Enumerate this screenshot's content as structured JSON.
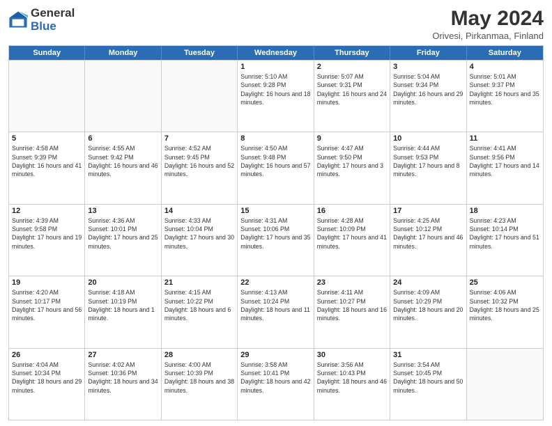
{
  "header": {
    "logo_general": "General",
    "logo_blue": "Blue",
    "month_year": "May 2024",
    "location": "Orivesi, Pirkanmaa, Finland"
  },
  "weekdays": [
    "Sunday",
    "Monday",
    "Tuesday",
    "Wednesday",
    "Thursday",
    "Friday",
    "Saturday"
  ],
  "weeks": [
    [
      {
        "day": "",
        "sunrise": "",
        "sunset": "",
        "daylight": ""
      },
      {
        "day": "",
        "sunrise": "",
        "sunset": "",
        "daylight": ""
      },
      {
        "day": "",
        "sunrise": "",
        "sunset": "",
        "daylight": ""
      },
      {
        "day": "1",
        "sunrise": "Sunrise: 5:10 AM",
        "sunset": "Sunset: 9:28 PM",
        "daylight": "Daylight: 16 hours and 18 minutes."
      },
      {
        "day": "2",
        "sunrise": "Sunrise: 5:07 AM",
        "sunset": "Sunset: 9:31 PM",
        "daylight": "Daylight: 16 hours and 24 minutes."
      },
      {
        "day": "3",
        "sunrise": "Sunrise: 5:04 AM",
        "sunset": "Sunset: 9:34 PM",
        "daylight": "Daylight: 16 hours and 29 minutes."
      },
      {
        "day": "4",
        "sunrise": "Sunrise: 5:01 AM",
        "sunset": "Sunset: 9:37 PM",
        "daylight": "Daylight: 16 hours and 35 minutes."
      }
    ],
    [
      {
        "day": "5",
        "sunrise": "Sunrise: 4:58 AM",
        "sunset": "Sunset: 9:39 PM",
        "daylight": "Daylight: 16 hours and 41 minutes."
      },
      {
        "day": "6",
        "sunrise": "Sunrise: 4:55 AM",
        "sunset": "Sunset: 9:42 PM",
        "daylight": "Daylight: 16 hours and 46 minutes."
      },
      {
        "day": "7",
        "sunrise": "Sunrise: 4:52 AM",
        "sunset": "Sunset: 9:45 PM",
        "daylight": "Daylight: 16 hours and 52 minutes."
      },
      {
        "day": "8",
        "sunrise": "Sunrise: 4:50 AM",
        "sunset": "Sunset: 9:48 PM",
        "daylight": "Daylight: 16 hours and 57 minutes."
      },
      {
        "day": "9",
        "sunrise": "Sunrise: 4:47 AM",
        "sunset": "Sunset: 9:50 PM",
        "daylight": "Daylight: 17 hours and 3 minutes."
      },
      {
        "day": "10",
        "sunrise": "Sunrise: 4:44 AM",
        "sunset": "Sunset: 9:53 PM",
        "daylight": "Daylight: 17 hours and 8 minutes."
      },
      {
        "day": "11",
        "sunrise": "Sunrise: 4:41 AM",
        "sunset": "Sunset: 9:56 PM",
        "daylight": "Daylight: 17 hours and 14 minutes."
      }
    ],
    [
      {
        "day": "12",
        "sunrise": "Sunrise: 4:39 AM",
        "sunset": "Sunset: 9:58 PM",
        "daylight": "Daylight: 17 hours and 19 minutes."
      },
      {
        "day": "13",
        "sunrise": "Sunrise: 4:36 AM",
        "sunset": "Sunset: 10:01 PM",
        "daylight": "Daylight: 17 hours and 25 minutes."
      },
      {
        "day": "14",
        "sunrise": "Sunrise: 4:33 AM",
        "sunset": "Sunset: 10:04 PM",
        "daylight": "Daylight: 17 hours and 30 minutes."
      },
      {
        "day": "15",
        "sunrise": "Sunrise: 4:31 AM",
        "sunset": "Sunset: 10:06 PM",
        "daylight": "Daylight: 17 hours and 35 minutes."
      },
      {
        "day": "16",
        "sunrise": "Sunrise: 4:28 AM",
        "sunset": "Sunset: 10:09 PM",
        "daylight": "Daylight: 17 hours and 41 minutes."
      },
      {
        "day": "17",
        "sunrise": "Sunrise: 4:25 AM",
        "sunset": "Sunset: 10:12 PM",
        "daylight": "Daylight: 17 hours and 46 minutes."
      },
      {
        "day": "18",
        "sunrise": "Sunrise: 4:23 AM",
        "sunset": "Sunset: 10:14 PM",
        "daylight": "Daylight: 17 hours and 51 minutes."
      }
    ],
    [
      {
        "day": "19",
        "sunrise": "Sunrise: 4:20 AM",
        "sunset": "Sunset: 10:17 PM",
        "daylight": "Daylight: 17 hours and 56 minutes."
      },
      {
        "day": "20",
        "sunrise": "Sunrise: 4:18 AM",
        "sunset": "Sunset: 10:19 PM",
        "daylight": "Daylight: 18 hours and 1 minute."
      },
      {
        "day": "21",
        "sunrise": "Sunrise: 4:15 AM",
        "sunset": "Sunset: 10:22 PM",
        "daylight": "Daylight: 18 hours and 6 minutes."
      },
      {
        "day": "22",
        "sunrise": "Sunrise: 4:13 AM",
        "sunset": "Sunset: 10:24 PM",
        "daylight": "Daylight: 18 hours and 11 minutes."
      },
      {
        "day": "23",
        "sunrise": "Sunrise: 4:11 AM",
        "sunset": "Sunset: 10:27 PM",
        "daylight": "Daylight: 18 hours and 16 minutes."
      },
      {
        "day": "24",
        "sunrise": "Sunrise: 4:09 AM",
        "sunset": "Sunset: 10:29 PM",
        "daylight": "Daylight: 18 hours and 20 minutes."
      },
      {
        "day": "25",
        "sunrise": "Sunrise: 4:06 AM",
        "sunset": "Sunset: 10:32 PM",
        "daylight": "Daylight: 18 hours and 25 minutes."
      }
    ],
    [
      {
        "day": "26",
        "sunrise": "Sunrise: 4:04 AM",
        "sunset": "Sunset: 10:34 PM",
        "daylight": "Daylight: 18 hours and 29 minutes."
      },
      {
        "day": "27",
        "sunrise": "Sunrise: 4:02 AM",
        "sunset": "Sunset: 10:36 PM",
        "daylight": "Daylight: 18 hours and 34 minutes."
      },
      {
        "day": "28",
        "sunrise": "Sunrise: 4:00 AM",
        "sunset": "Sunset: 10:39 PM",
        "daylight": "Daylight: 18 hours and 38 minutes."
      },
      {
        "day": "29",
        "sunrise": "Sunrise: 3:58 AM",
        "sunset": "Sunset: 10:41 PM",
        "daylight": "Daylight: 18 hours and 42 minutes."
      },
      {
        "day": "30",
        "sunrise": "Sunrise: 3:56 AM",
        "sunset": "Sunset: 10:43 PM",
        "daylight": "Daylight: 18 hours and 46 minutes."
      },
      {
        "day": "31",
        "sunrise": "Sunrise: 3:54 AM",
        "sunset": "Sunset: 10:45 PM",
        "daylight": "Daylight: 18 hours and 50 minutes."
      },
      {
        "day": "",
        "sunrise": "",
        "sunset": "",
        "daylight": ""
      }
    ]
  ]
}
